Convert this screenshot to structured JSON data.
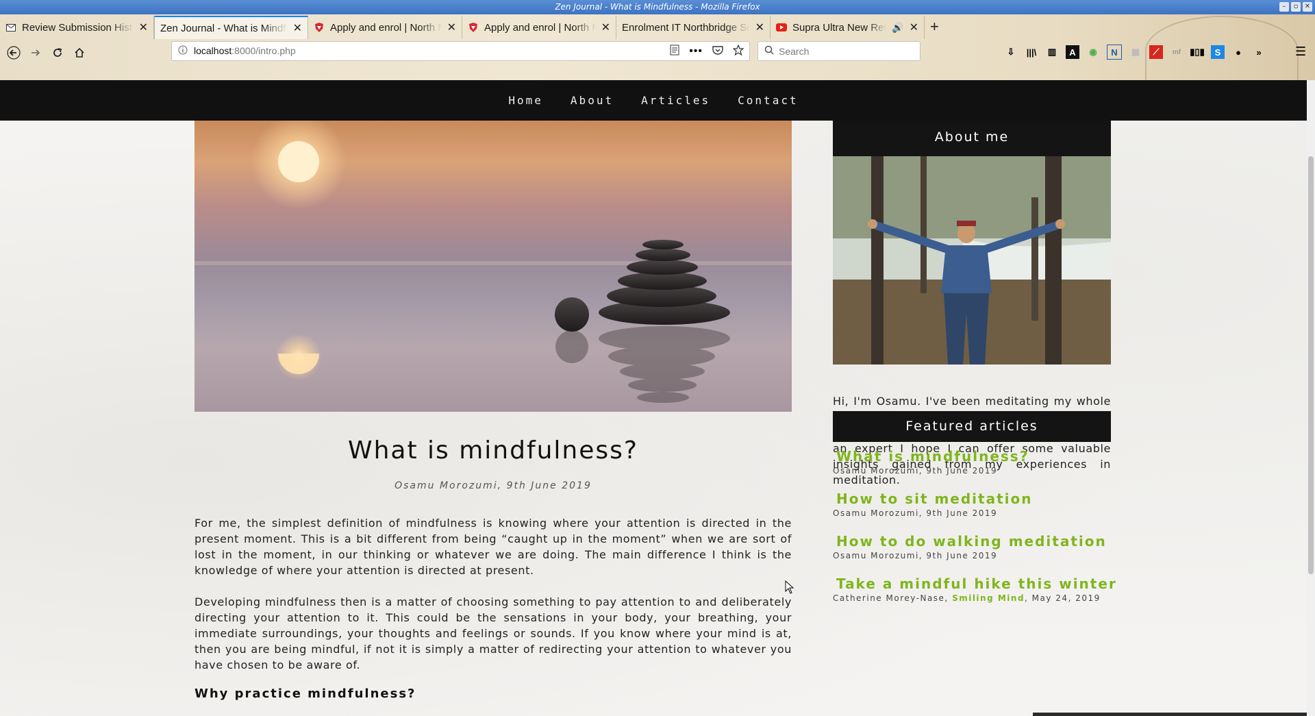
{
  "window": {
    "title": "Zen Journal - What is Mindfulness - Mozilla Firefox",
    "controls": [
      "minimize",
      "restore",
      "close"
    ]
  },
  "tabs": [
    {
      "label": "Review Submission Hist",
      "favicon": "mail-icon",
      "active": false
    },
    {
      "label": "Zen Journal - What is Mindfu",
      "favicon": "none",
      "active": true
    },
    {
      "label": "Apply and enrol | North M",
      "favicon": "shield-icon",
      "active": false
    },
    {
      "label": "Apply and enrol | North M",
      "favicon": "shield-icon",
      "active": false
    },
    {
      "label": "Enrolment IT Northbridge Se",
      "favicon": "none",
      "active": false
    },
    {
      "label": "Supra Ultra New Retro",
      "favicon": "youtube-icon",
      "active": false,
      "audio": true
    }
  ],
  "toolbar": {
    "url_host": "localhost",
    "url_rest": ":8000/intro.php",
    "search_placeholder": "Search"
  },
  "site": {
    "nav": [
      "Home",
      "About",
      "Articles",
      "Contact"
    ]
  },
  "article": {
    "title": "What is mindfulness?",
    "byline": "Osamu Morozumi, 9th June 2019",
    "paragraphs": [
      "For me, the simplest definition of mindfulness is knowing where your attention is directed in the present moment. This is a bit different from being “caught up in the moment” when we are sort of lost in the moment, in our thinking or whatever we are doing. The main difference I think is the knowledge of where your attention is directed at present.",
      "Developing mindfulness then is a matter of choosing something to pay attention to and deliberately directing your attention to it. This could be the sensations in your body, your breathing, your immediate surroundings, your thoughts and feelings or sounds. If you know where your mind is at, then you are being mindful, if not it is simply a matter of redirecting your attention to whatever you have chosen to be aware of."
    ],
    "subheading": "Why practice mindfulness?"
  },
  "sidebar": {
    "about_heading": "About me",
    "about_text": "Hi, I'm Osamu. I've been meditating my whole adult life, following both the Theravada Buddhist and secular traditions. While I'm not an expert I hope I can offer some valuable insights gained from my experiences in meditation.",
    "featured_heading": "Featured articles",
    "featured": [
      {
        "title": "What is mindfulness?",
        "meta": "Osamu Morozumi, 9th June 2019"
      },
      {
        "title": "How to sit meditation",
        "meta": "Osamu Morozumi, 9th June 2019"
      },
      {
        "title": "How to do walking meditation",
        "meta": "Osamu Morozumi, 9th June 2019"
      },
      {
        "title": "Take a mindful hike this winter",
        "meta_author": "Catherine Morey-Nase, ",
        "meta_link": "Smiling Mind",
        "meta_date": ", May 24, 2019"
      }
    ]
  },
  "colors": {
    "accent_green": "#7fb51d",
    "nav_bg": "#111111",
    "titlebar_blue": "#3d73c2"
  }
}
